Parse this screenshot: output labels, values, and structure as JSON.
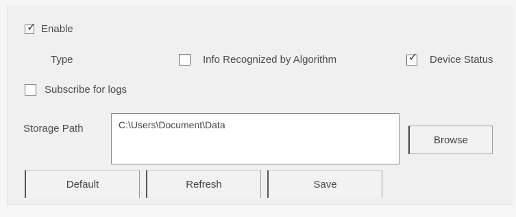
{
  "enable": {
    "label": "Enable",
    "checked": true
  },
  "type": {
    "label": "Type",
    "options": [
      {
        "label": "Info Recognized by Algorithm",
        "checked": false
      },
      {
        "label": "Device Status",
        "checked": true
      }
    ]
  },
  "subscribe": {
    "label": "Subscribe for logs",
    "checked": false
  },
  "storage": {
    "label": "Storage Path",
    "value": "C:\\Users\\Document\\Data"
  },
  "buttons": {
    "browse": "Browse",
    "default": "Default",
    "refresh": "Refresh",
    "save": "Save"
  },
  "icons": {
    "check": "checkmark-icon"
  }
}
